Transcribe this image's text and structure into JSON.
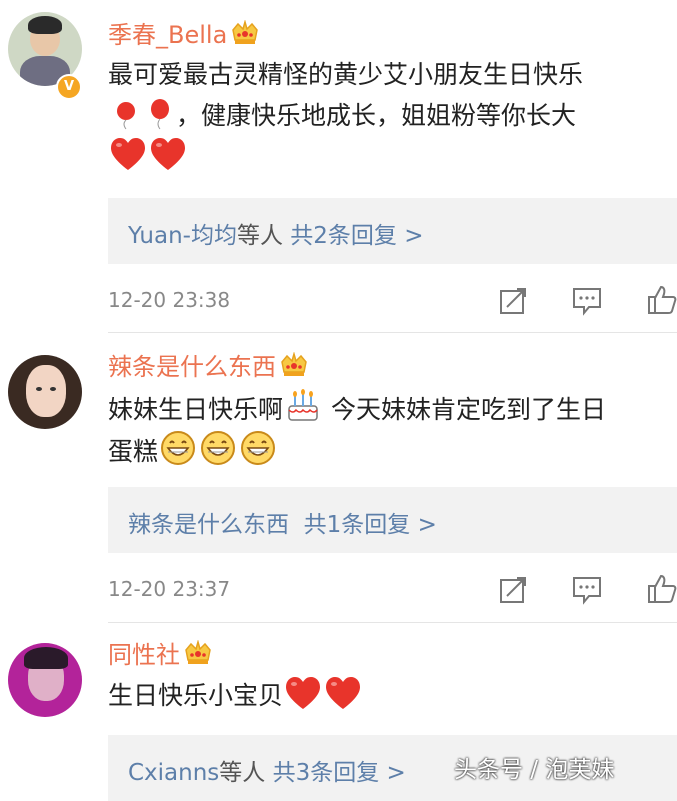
{
  "comments": [
    {
      "username": "季春_Bella",
      "text_line1": "最可爱最古灵精怪的黄少艾小朋友生日快乐",
      "text_line2": "，健康快乐地成长，姐姐粉等你长大",
      "reply_users": "Yuan-均均",
      "reply_mid": "等人",
      "reply_count": "共2条回复 >",
      "time": "12-20 23:38"
    },
    {
      "username": "辣条是什么东西",
      "text_line1": "妹妹生日快乐啊",
      "text_line1b": " 今天妹妹肯定吃到了生日",
      "text_line2": "蛋糕",
      "reply_users": "辣条是什么东西",
      "reply_count": "共1条回复 >",
      "time": "12-20 23:37"
    },
    {
      "username": "同性社",
      "text_line1": "生日快乐小宝贝",
      "reply_users": "Cxianns",
      "reply_mid": "等人",
      "reply_count": "共3条回复 >"
    }
  ],
  "icons": {
    "verified": "verified-badge-icon",
    "crown": "vip-crown-icon",
    "share": "share-icon",
    "comment": "comment-icon",
    "like": "like-icon",
    "heart": "heart-emoji-icon",
    "balloon": "balloon-emoji-icon",
    "cake": "cake-emoji-icon",
    "grin": "grin-emoji-icon"
  },
  "colors": {
    "username": "#eb7350",
    "reply_link": "#5d7fa9",
    "reply_bg": "#f2f2f2",
    "heart": "#e8342b"
  },
  "watermark": "头条号 / 泡芙妹"
}
